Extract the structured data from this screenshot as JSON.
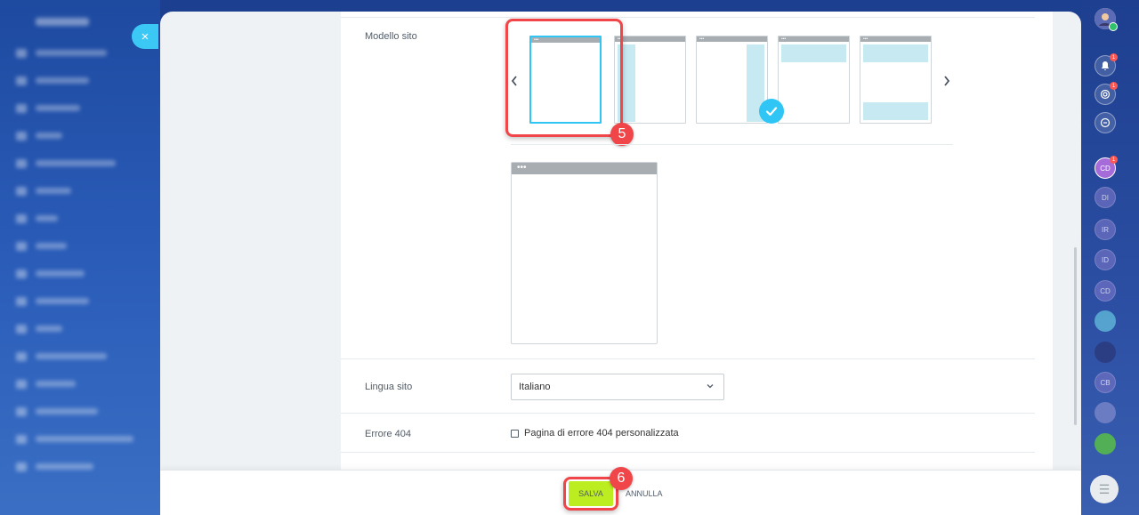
{
  "background": {
    "logo_text": "Bitrix24"
  },
  "close_button": {
    "label": "×"
  },
  "form": {
    "site_template_label": "Modello sito",
    "carousel_prev": "‹",
    "carousel_next": "›",
    "templates": [
      "template-plain",
      "template-left-sidebar",
      "template-right-sidebar",
      "template-header",
      "template-header-footer"
    ],
    "selected_template_index": 0,
    "preview_dots": "•••",
    "thumb_dots": "•••",
    "language_label": "Lingua sito",
    "language_value": "Italiano",
    "error404_label": "Errore 404",
    "error404_checkbox_label": "Pagina di errore 404 personalizzata"
  },
  "annotations": {
    "step5": "5",
    "step6": "6"
  },
  "footer": {
    "save_label": "SALVA",
    "cancel_label": "ANNULLA"
  },
  "rail": {
    "badges": {
      "notifications": "1",
      "activity": "1",
      "avatar_cd": "1"
    },
    "avatars": [
      "CD",
      "DI",
      "IR",
      "ID",
      "CD",
      "",
      "",
      "CB",
      "",
      ""
    ]
  },
  "colors": {
    "accent": "#2fc6f6",
    "save": "#bbed21",
    "highlight": "#f0464a"
  }
}
